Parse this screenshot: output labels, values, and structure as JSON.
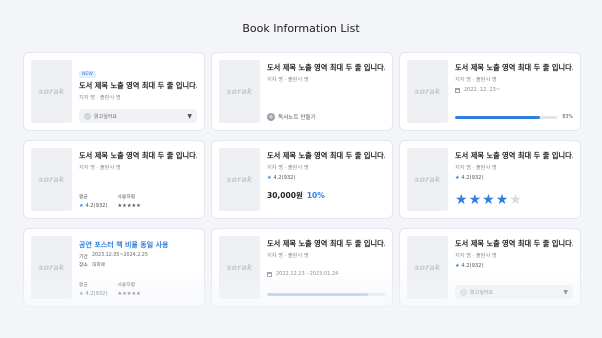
{
  "page": {
    "title": "Book Information List"
  },
  "cover_text": "sorak",
  "book": {
    "title": "도서 제목 노출 영역 최대 두 줄 입니다.",
    "meta": "지자 명 · 출판사 명"
  },
  "cards": {
    "c1": {
      "tag": "NEW",
      "select_label": "읽고싶어요"
    },
    "c2": {
      "note_label": "독서노트 만들기"
    },
    "c3": {
      "date": "2022. 12. 23~",
      "progress": 0.83,
      "progress_text": "83%"
    },
    "c4": {
      "avg_caption": "평균",
      "avg_value": "4.2(932)",
      "my_caption": "사용자평",
      "my_stars": 5
    },
    "c5": {
      "rating": "4.2(932)",
      "price": "30,000원",
      "discount": "10%"
    },
    "c6": {
      "rating": "4.2(932)",
      "stars": 4,
      "stars_total": 5
    },
    "c7": {
      "title": "공연 포스터 책 비율 동일 사용",
      "period_key": "기간",
      "period_val": "2023.12.05~2024.2.25",
      "place_key": "장소",
      "place_val": "대학로",
      "avg_caption": "평균",
      "avg_value": "4.2(932)",
      "my_caption": "사용자평",
      "my_stars": 5
    },
    "c8": {
      "date": "2022.12.23 - 2023.01.24",
      "progress": 0.86
    },
    "c9": {
      "rating": "4.2(932)",
      "select_label": "읽고싶어요"
    }
  },
  "colors": {
    "accent": "#2f7fe0",
    "background": "#f3f5f9"
  }
}
